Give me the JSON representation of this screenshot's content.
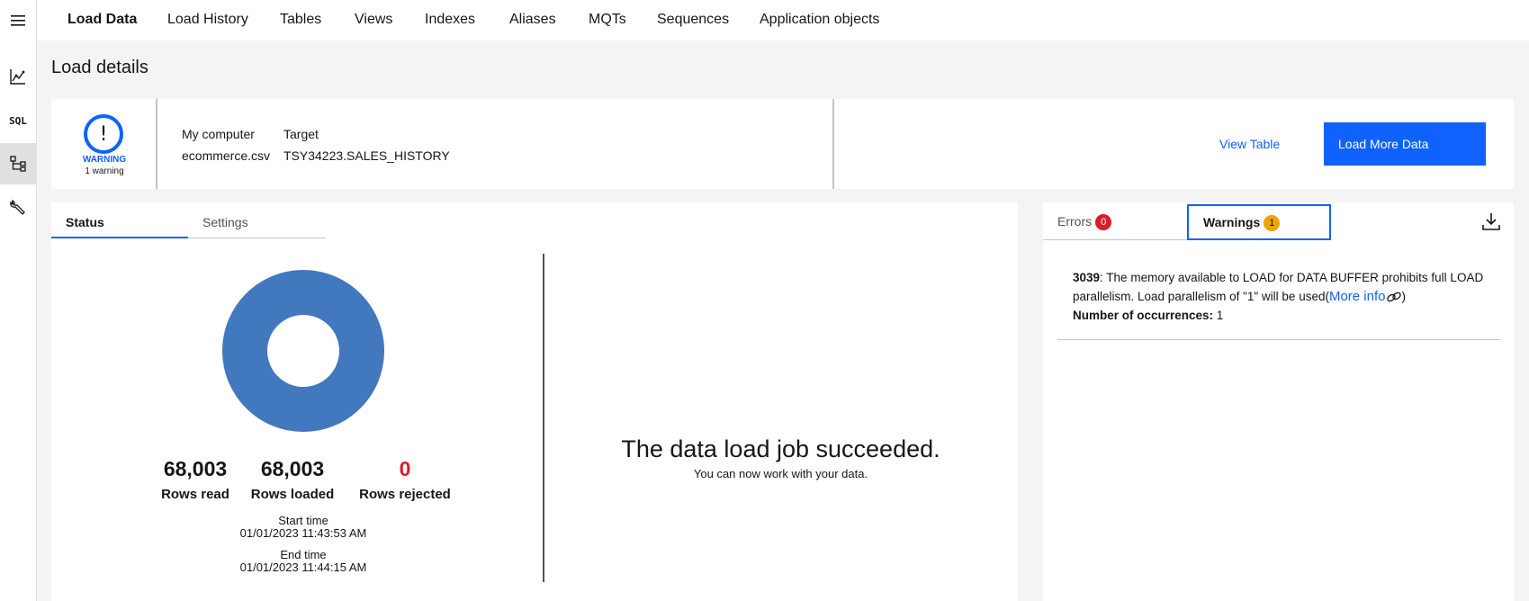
{
  "rail": {
    "items": [
      {
        "icon": "menu-icon"
      },
      {
        "icon": "chart-icon"
      },
      {
        "label": "SQL"
      },
      {
        "icon": "data-tree-icon"
      },
      {
        "icon": "wrench-icon"
      }
    ]
  },
  "nav": {
    "tabs": [
      {
        "label": "Load Data",
        "active": true
      },
      {
        "label": "Load History"
      },
      {
        "label": "Tables"
      },
      {
        "label": "Views"
      },
      {
        "label": "Indexes"
      },
      {
        "label": "Aliases"
      },
      {
        "label": "MQTs"
      },
      {
        "label": "Sequences"
      },
      {
        "label": "Application objects"
      }
    ]
  },
  "page": {
    "title": "Load details"
  },
  "details": {
    "status_symbol": "!",
    "status_label": "WARNING",
    "status_count": "1 warning",
    "source_header": "My computer",
    "source_value": "ecommerce.csv",
    "target_header": "Target",
    "target_value": "TSY34223.SALES_HISTORY",
    "view_table_label": "View Table",
    "load_more_label": "Load More Data"
  },
  "status_panel": {
    "tabs": [
      {
        "label": "Status",
        "active": true
      },
      {
        "label": "Settings"
      }
    ],
    "rows_read": "68,003",
    "rows_read_label": "Rows read",
    "rows_loaded": "68,003",
    "rows_loaded_label": "Rows loaded",
    "rows_rejected": "0",
    "rows_rejected_label": "Rows rejected",
    "start_label": "Start time",
    "start_value": "01/01/2023 11:43:53 AM",
    "end_label": "End time",
    "end_value": "01/01/2023 11:44:15 AM",
    "success_title": "The data load job succeeded.",
    "success_sub": "You can now work with your data.",
    "donut_color": "#4178be",
    "loaded_fraction": 1.0
  },
  "messages": {
    "errors_label": "Errors",
    "errors_count": "0",
    "warnings_label": "Warnings",
    "warnings_count": "1",
    "download_icon": "download-icon",
    "warning": {
      "code": "3039",
      "text": ": The memory available to LOAD for DATA BUFFER prohibits full LOAD parallelism. Load parallelism of \"1\" will be used(",
      "link": "More info",
      "close": ")",
      "occ_label": "Number of occurrences:",
      "occ_value": " 1"
    }
  },
  "colors": {
    "accent": "#0f62fe",
    "error": "#da1e28",
    "warning": "#f1a208"
  }
}
